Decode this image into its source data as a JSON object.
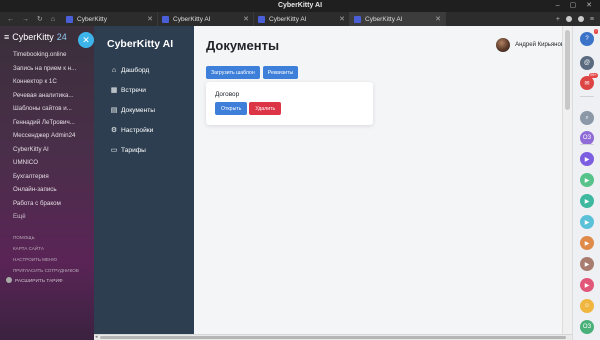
{
  "window": {
    "title": "CyberKitty AI",
    "controls": "– ▢ ✕"
  },
  "browser": {
    "nav": [
      "←",
      "→",
      "↻",
      "⌂"
    ],
    "tabs": [
      {
        "label": "CyberKitty",
        "active": false
      },
      {
        "label": "CyberKitty AI",
        "active": false
      },
      {
        "label": "CyberKitty AI",
        "active": false
      },
      {
        "label": "CyberKitty AI",
        "active": true
      }
    ],
    "tab_close": "✕",
    "new_tab": "+",
    "menu": "≡"
  },
  "left_sidebar": {
    "logo": "CyberKitty",
    "version": "24",
    "items": [
      "Timebooking.online",
      "Запись на прием к н...",
      "Коннектор к 1С",
      "Речевая аналитика...",
      "Шаблоны сайтов и...",
      "Геннадий ЛеТрович...",
      "Мессенджер Admin24",
      "CyberKitty AI",
      "UMNICO",
      "Бухгалтерия",
      "Онлайн-запись",
      "Работа с браком",
      "Ещё"
    ],
    "small_links": [
      "Помощь",
      "Карта сайта",
      "Настроить меню",
      "Пригласить сотрудников"
    ],
    "expand_label": "Расширить тариф"
  },
  "app_sidebar": {
    "brand": "CyberKitty AI",
    "nav": [
      {
        "label": "Дашборд",
        "icon": "home-icon",
        "glyph": "⌂"
      },
      {
        "label": "Встречи",
        "icon": "calendar-icon",
        "glyph": "▦"
      },
      {
        "label": "Документы",
        "icon": "document-icon",
        "glyph": "▤"
      },
      {
        "label": "Настройки",
        "icon": "gear-icon",
        "glyph": "⚙"
      },
      {
        "label": "Тарифы",
        "icon": "card-icon",
        "glyph": "▭"
      }
    ]
  },
  "main": {
    "title": "Документы",
    "user_name": "Андрей Кирьянов",
    "buttons": {
      "upload": "Загрузить шаблон",
      "requisites": "Реквизиты"
    },
    "document": {
      "title": "Договор",
      "open": "Открыть",
      "delete": "Удалить"
    }
  },
  "right_bar": {
    "icons": [
      {
        "name": "help-icon",
        "color": "#3b73c9",
        "glyph": "?",
        "badge": "!"
      },
      {
        "name": "at-icon",
        "color": "#5a6b80",
        "glyph": "@"
      },
      {
        "name": "chat-icon",
        "color": "#d44",
        "glyph": "✉",
        "badge": "99+"
      },
      {
        "name": "search-icon",
        "color": "#8b98a8",
        "glyph": "⌕"
      },
      {
        "name": "group-chat-icon",
        "color": "#8e6bd6",
        "glyph": "ОЗ"
      },
      {
        "name": "video-icon",
        "color": "#7c5ee0",
        "glyph": "▶"
      },
      {
        "name": "video-icon",
        "color": "#57c28a",
        "glyph": "▶"
      },
      {
        "name": "video-icon",
        "color": "#3fb8a0",
        "glyph": "▶"
      },
      {
        "name": "video-icon",
        "color": "#5bc1d8",
        "glyph": "▶"
      },
      {
        "name": "video-icon",
        "color": "#e08a4a",
        "glyph": "▶"
      },
      {
        "name": "video-icon",
        "color": "#a87c6e",
        "glyph": "▶"
      },
      {
        "name": "video-icon",
        "color": "#e0577a",
        "glyph": "▶"
      },
      {
        "name": "group-icon",
        "color": "#f0b640",
        "glyph": "☺"
      },
      {
        "name": "group-chat-icon",
        "color": "#4ab07a",
        "glyph": "ОЗ"
      },
      {
        "name": "video-icon",
        "color": "#6fb7d8",
        "glyph": "▶"
      },
      {
        "name": "video-icon",
        "color": "#4a9fd1",
        "glyph": "▶"
      }
    ]
  },
  "colors": {
    "app_sidebar_bg": "#2c3e50",
    "primary": "#3d7fd9",
    "danger": "#dc3545",
    "accent": "#3cb4ea"
  }
}
